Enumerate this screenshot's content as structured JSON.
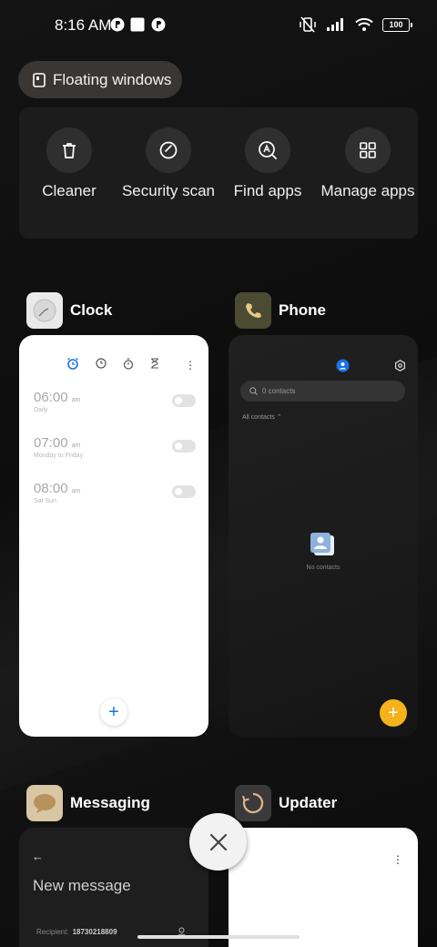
{
  "status_bar": {
    "time": "8:16 AM",
    "battery": "100"
  },
  "floating_windows": {
    "label": "Floating windows"
  },
  "tools": [
    {
      "label": "Cleaner",
      "icon": "trash-icon"
    },
    {
      "label": "Security scan",
      "icon": "shield-check-icon"
    },
    {
      "label": "Find apps",
      "icon": "find-apps-icon"
    },
    {
      "label": "Manage apps",
      "icon": "grid-icon"
    }
  ],
  "apps": {
    "clock": {
      "name": "Clock",
      "alarms": [
        {
          "time": "06:00",
          "ampm": "am",
          "repeat": "Daily"
        },
        {
          "time": "07:00",
          "ampm": "am",
          "repeat": "Monday to Friday"
        },
        {
          "time": "08:00",
          "ampm": "am",
          "repeat": "Sat Sun"
        }
      ],
      "fab": "+"
    },
    "phone": {
      "name": "Phone",
      "search_placeholder": "0 contacts",
      "filter": "All contacts",
      "empty_text": "No contacts",
      "fab": "+"
    },
    "messaging": {
      "name": "Messaging",
      "title": "New message",
      "recipient_label": "Recipient:",
      "recipient_number": "18730218809"
    },
    "updater": {
      "name": "Updater"
    }
  },
  "colors": {
    "accent_blue": "#1a73e8",
    "phone_fab": "#f5b21b",
    "pill_bg": "#3a3633",
    "panel_bg": "#1c1c1c"
  }
}
